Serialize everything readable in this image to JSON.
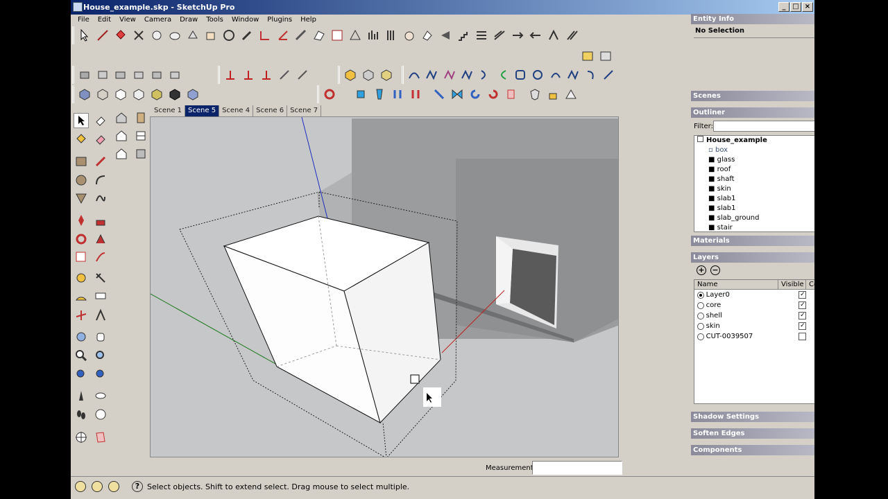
{
  "window": {
    "title": "House_example.skp - SketchUp Pro"
  },
  "menu": [
    "File",
    "Edit",
    "View",
    "Camera",
    "Draw",
    "Tools",
    "Window",
    "Plugins",
    "Help"
  ],
  "scenes": {
    "tabs": [
      "Scene 1",
      "Scene 5",
      "Scene 4",
      "Scene 6",
      "Scene 7"
    ],
    "active": 1
  },
  "entity_info": {
    "title": "Entity Info",
    "selection": "No Selection"
  },
  "panels": {
    "scenes": "Scenes",
    "outliner": "Outliner",
    "materials": "Materials",
    "layers": "Layers",
    "shadow": "Shadow Settings",
    "soften": "Soften Edges",
    "components": "Components"
  },
  "outliner": {
    "filter_label": "Filter:",
    "filter_value": "",
    "root": "House_example",
    "items": [
      "box",
      "glass",
      "roof",
      "shaft",
      "skin",
      "slab1",
      "slab1",
      "slab_ground",
      "stair"
    ]
  },
  "layers": {
    "columns": {
      "name": "Name",
      "visible": "Visible",
      "color": "Color"
    },
    "rows": [
      {
        "name": "Layer0",
        "active": true,
        "visible": true,
        "color": "#e84c4c"
      },
      {
        "name": "core",
        "active": false,
        "visible": true,
        "color": "#b03040"
      },
      {
        "name": "shell",
        "active": false,
        "visible": true,
        "color": "#10a080"
      },
      {
        "name": "skin",
        "active": false,
        "visible": true,
        "color": "#8088a8"
      },
      {
        "name": "CUT-0039507",
        "active": false,
        "visible": false,
        "color": "#9a10d0"
      }
    ]
  },
  "status": {
    "text": "Select objects. Shift to extend select. Drag mouse to select multiple.",
    "measurements_label": "Measurements",
    "measurements_value": ""
  },
  "colors": {
    "selection_blue": "#0a246a",
    "viewport_bg": "#c5c7c9"
  }
}
